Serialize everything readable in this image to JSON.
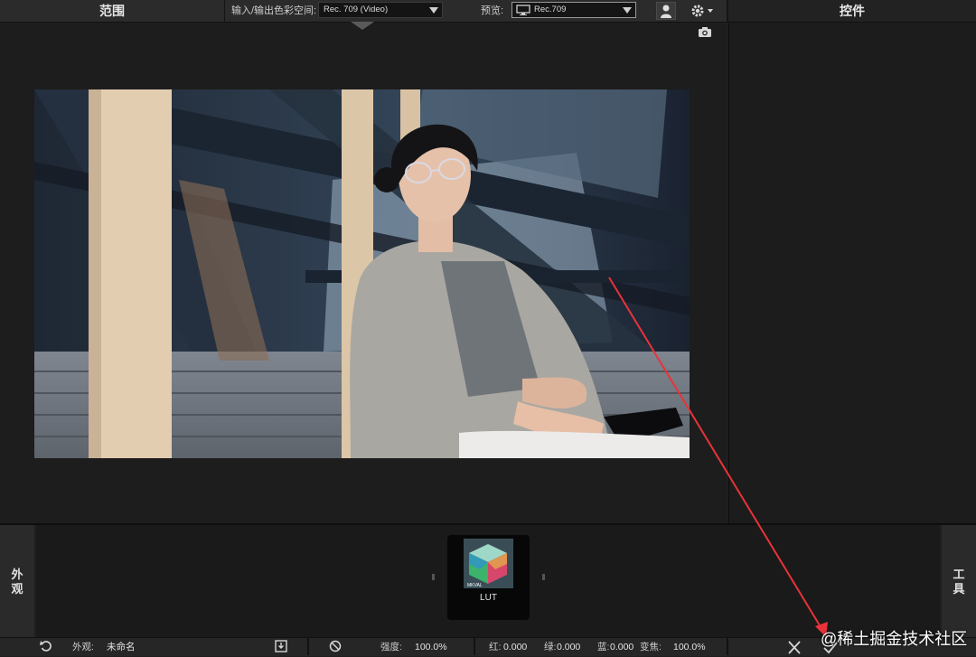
{
  "header": {
    "scope_title": "范围",
    "io_color_space_label": "输入/输出色彩空间:",
    "io_color_space_value": "Rec. 709 (Video)",
    "preview_label": "预览:",
    "preview_value": "Rec.709",
    "controls_title": "控件"
  },
  "looks": {
    "side_label": "外观",
    "tools_label": "工具",
    "items": [
      {
        "label": "LUT",
        "thumb_caption": "MKVAL"
      }
    ]
  },
  "bottom_bar": {
    "look_label": "外观:",
    "look_name": "未命名",
    "strength_label": "强度:",
    "strength_value": "100.0%",
    "red_label": "红:",
    "red_value": "0.000",
    "green_label": "绿:",
    "green_value": "0.000",
    "blue_label": "蓝:",
    "blue_value": "0.000",
    "transition_label": "变焦:",
    "transition_value": "100.0%"
  },
  "watermark": "@稀土掘金技术社区",
  "colors": {
    "background": "#1f1f1f",
    "panel": "#2b2b2b",
    "annotation_arrow": "#e8333a",
    "text": "#d6d6d6"
  }
}
